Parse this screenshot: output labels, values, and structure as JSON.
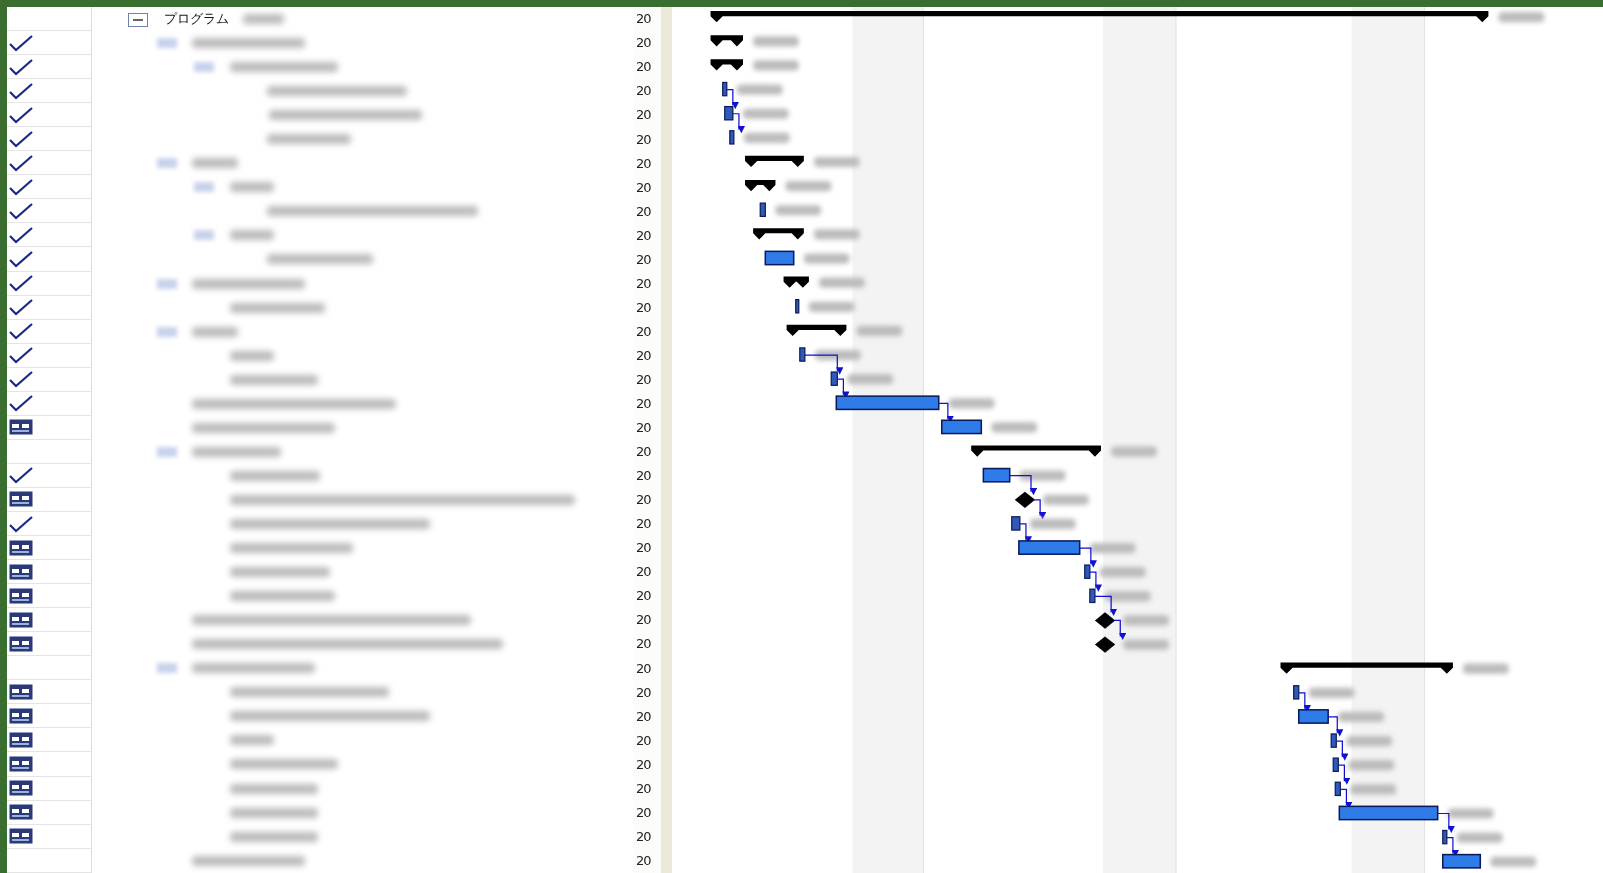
{
  "rows": [
    {
      "name": "プログラム",
      "expanded": true,
      "date": "20"
    },
    {
      "kind": "check",
      "date": "20"
    },
    {
      "kind": "check",
      "date": "20"
    },
    {
      "kind": "check",
      "date": "20"
    },
    {
      "kind": "check",
      "date": "20"
    },
    {
      "kind": "check",
      "date": "20"
    },
    {
      "kind": "check",
      "date": "20"
    },
    {
      "kind": "check",
      "date": "20"
    },
    {
      "kind": "check",
      "date": "20"
    },
    {
      "kind": "check",
      "date": "20"
    },
    {
      "kind": "check",
      "date": "20"
    },
    {
      "kind": "check",
      "date": "20"
    },
    {
      "kind": "check",
      "date": "20"
    },
    {
      "kind": "check",
      "date": "20"
    },
    {
      "kind": "check",
      "date": "20"
    },
    {
      "kind": "check",
      "date": "20"
    },
    {
      "kind": "check",
      "date": "20"
    },
    {
      "kind": "calendar",
      "date": "20"
    },
    {
      "date": "20"
    },
    {
      "kind": "check",
      "date": "20"
    },
    {
      "kind": "calendar",
      "date": "20"
    },
    {
      "kind": "check",
      "date": "20"
    },
    {
      "kind": "calendar",
      "date": "20"
    },
    {
      "kind": "calendar",
      "date": "20"
    },
    {
      "kind": "calendar",
      "date": "20"
    },
    {
      "kind": "calendar",
      "date": "20"
    },
    {
      "kind": "calendar",
      "date": "20"
    },
    {
      "date": "20"
    },
    {
      "kind": "calendar",
      "date": "20"
    },
    {
      "kind": "calendar",
      "date": "20"
    },
    {
      "kind": "calendar",
      "date": "20"
    },
    {
      "kind": "calendar",
      "date": "20"
    },
    {
      "kind": "calendar",
      "date": "20"
    },
    {
      "kind": "calendar",
      "date": "20"
    },
    {
      "kind": "calendar",
      "date": "20"
    },
    {
      "date": "20"
    }
  ]
}
